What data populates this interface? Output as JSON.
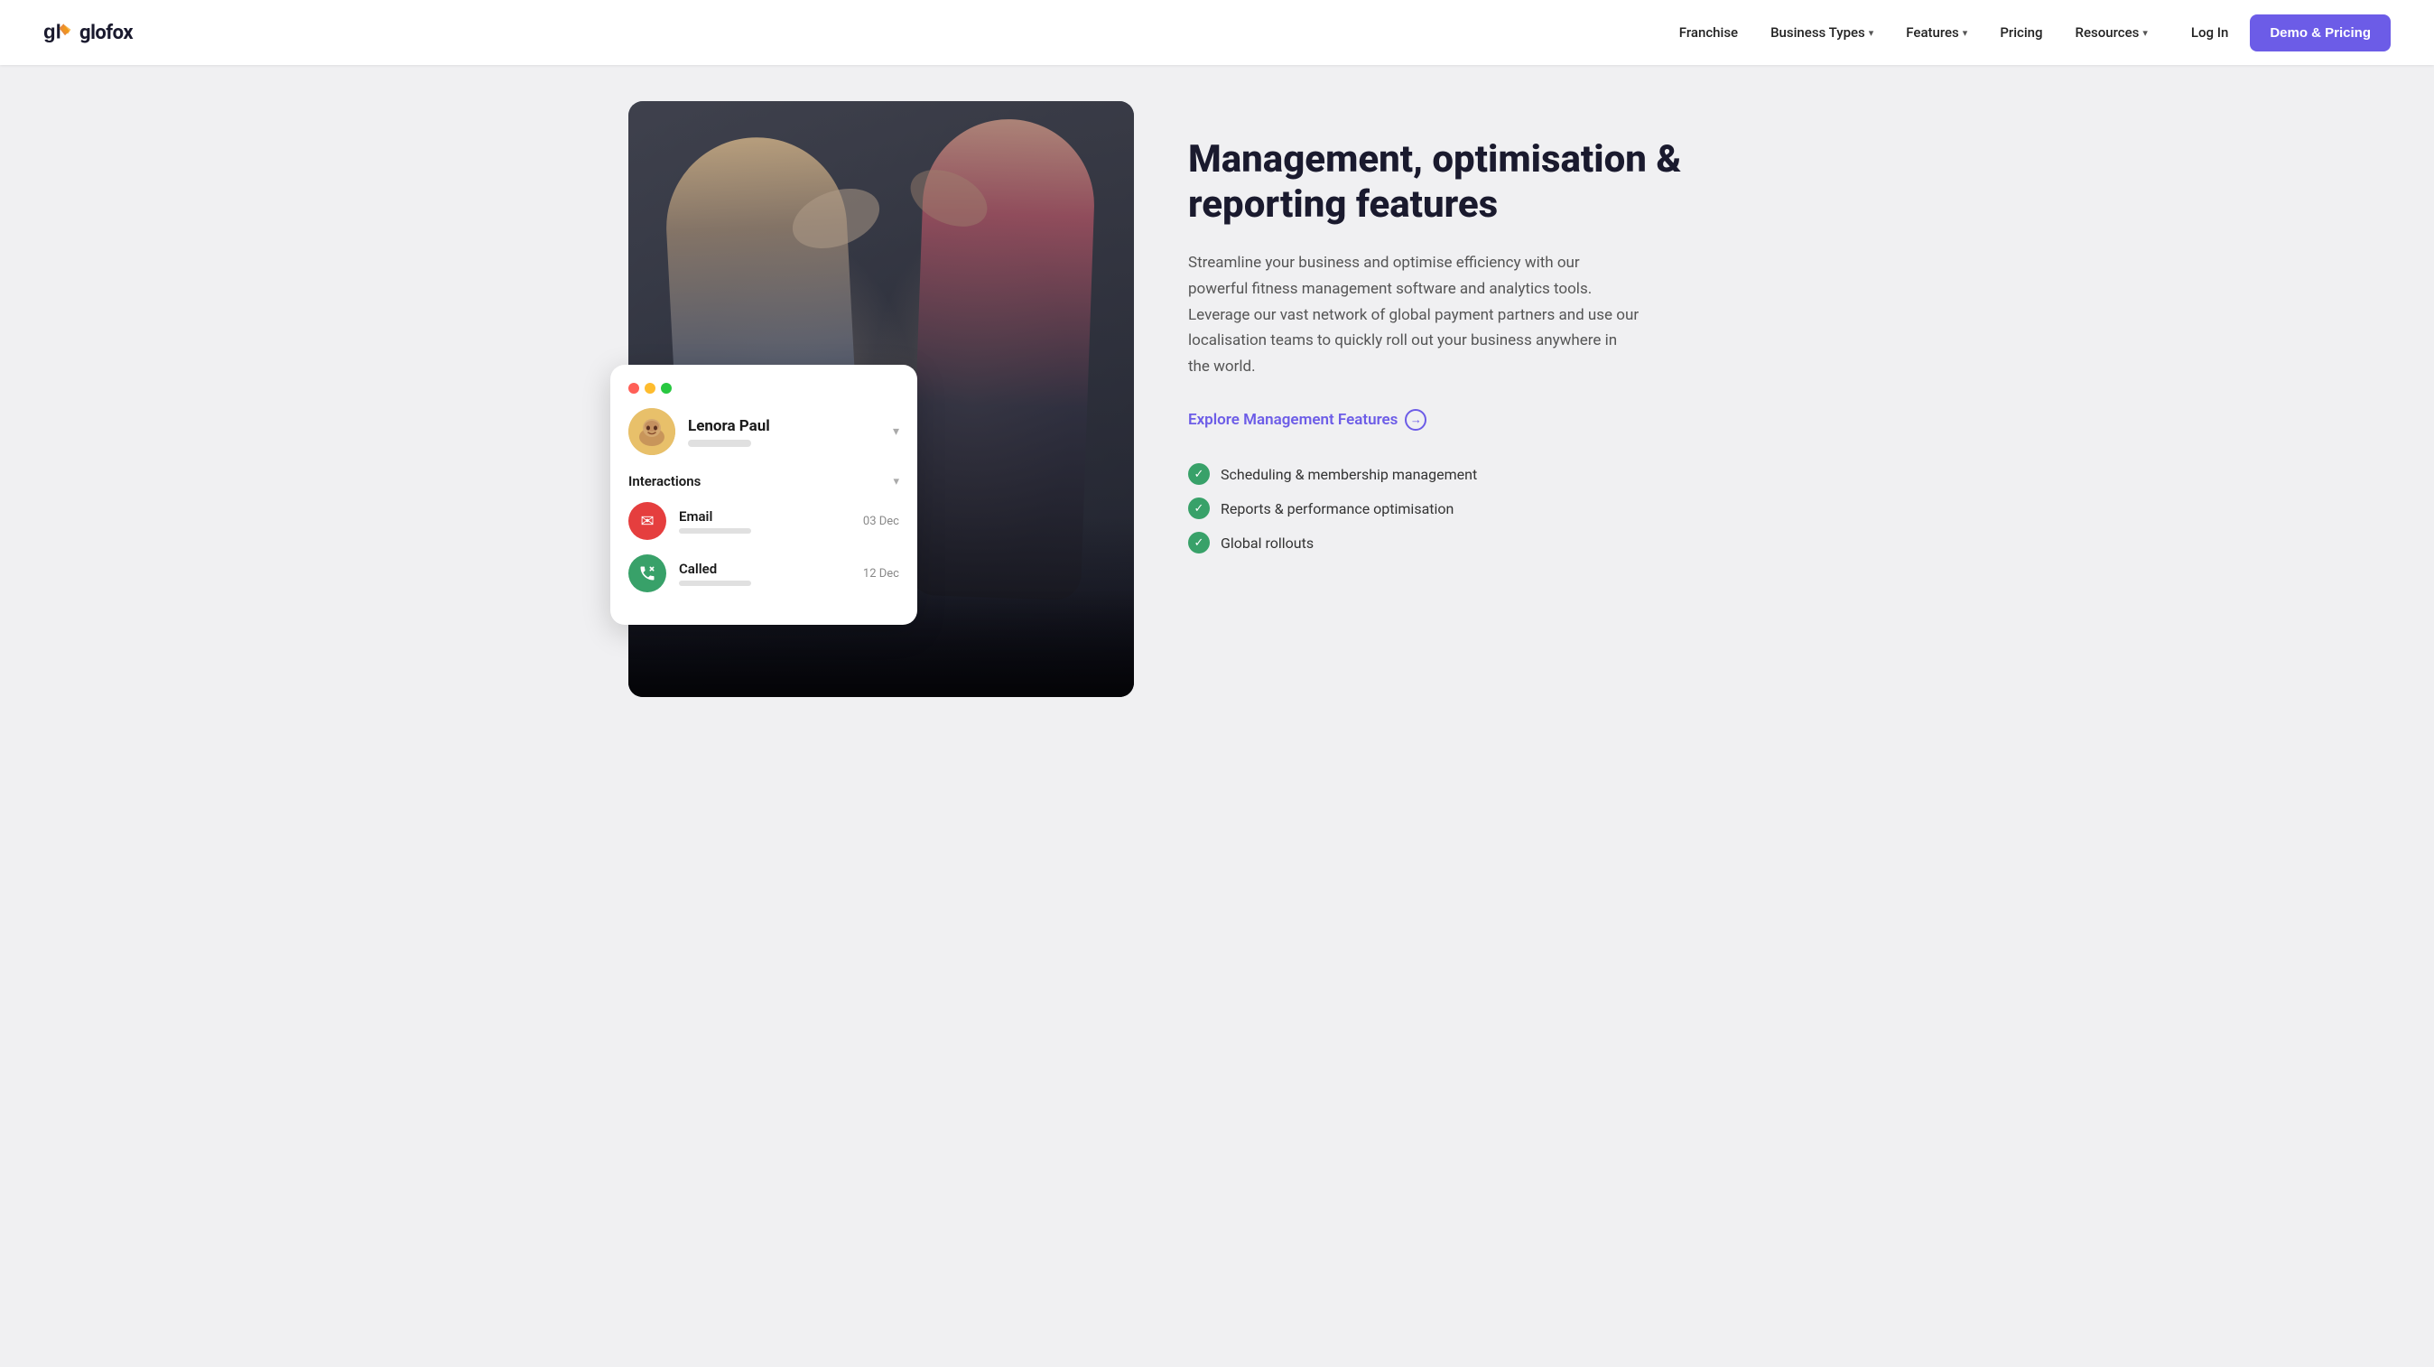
{
  "nav": {
    "logo_text": "glofox",
    "links": [
      {
        "label": "Franchise",
        "has_dropdown": false
      },
      {
        "label": "Business Types",
        "has_dropdown": true
      },
      {
        "label": "Features",
        "has_dropdown": true
      },
      {
        "label": "Pricing",
        "has_dropdown": false
      },
      {
        "label": "Resources",
        "has_dropdown": true
      }
    ],
    "login_label": "Log In",
    "cta_label": "Demo & Pricing"
  },
  "card": {
    "user_name": "Lenora Paul",
    "user_emoji": "👩",
    "section_label": "Interactions",
    "interactions": [
      {
        "type": "email",
        "label": "Email",
        "date": "03 Dec",
        "icon": "✉"
      },
      {
        "type": "call",
        "label": "Called",
        "date": "12 Dec",
        "icon": "📞"
      }
    ]
  },
  "content": {
    "heading": "Management, optimisation & reporting features",
    "description": "Streamline your business and optimise efficiency with our powerful fitness management software and analytics tools. Leverage our vast network of global payment partners and use our localisation teams to quickly roll out your business anywhere in the world.",
    "explore_label": "Explore Management Features",
    "features": [
      "Scheduling & membership management",
      "Reports & performance optimisation",
      "Global rollouts"
    ]
  }
}
